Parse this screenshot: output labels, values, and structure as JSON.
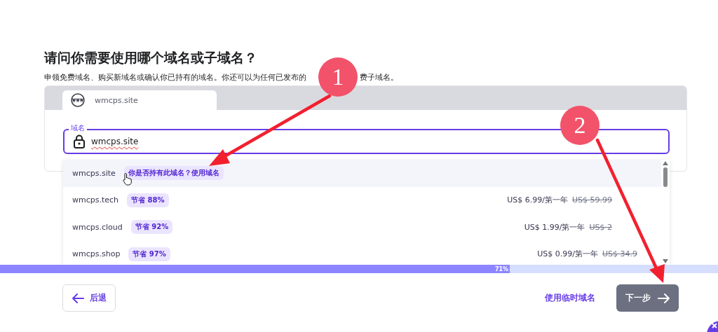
{
  "heading": "请问你需要使用哪个域名或子域名？",
  "description": [
    "申领免费域名、购买新域名或确认你已持有的域名。你还可以为任何已发布的",
    "费子域名。"
  ],
  "tabs": [
    {
      "label": "wmcps.site",
      "selected": true
    }
  ],
  "domain_field": {
    "label": "域名",
    "value": "wmcps.site"
  },
  "suggestions": [
    {
      "domain": "wmcps.site",
      "tag": "你是否持有此域名？使用域名",
      "hovered": true
    },
    {
      "domain": "wmcps.tech",
      "tag": "节省 88%",
      "price": "US$ 6.99/第一年",
      "old_price": "US$ 59.99",
      "hovered": false
    },
    {
      "domain": "wmcps.cloud",
      "tag": "节省 92%",
      "price": "US$ 1.99/第一年",
      "old_price": "US$ 2",
      "hovered": false
    },
    {
      "domain": "wmcps.shop",
      "tag": "节省 97%",
      "price": "US$ 0.99/第一年",
      "old_price": "US$ 34.9",
      "hovered": false
    }
  ],
  "progress": {
    "level": 0.71,
    "label": "71%"
  },
  "back_button": "后退",
  "temp_domain_link": "使用临时域名",
  "next_button": "下一步",
  "annotations": [
    {
      "number": "1"
    },
    {
      "number": "2"
    }
  ]
}
